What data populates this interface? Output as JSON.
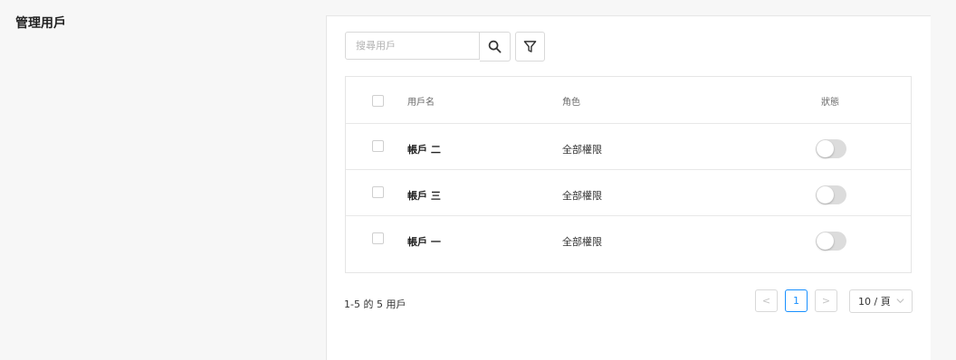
{
  "page": {
    "title": "管理用戶"
  },
  "toolbar": {
    "search_placeholder": "搜尋用戶",
    "search_icon": "search-icon",
    "filter_icon": "filter-icon"
  },
  "table": {
    "columns": {
      "name": "用戶名",
      "role": "角色",
      "status": "狀態"
    },
    "rows": [
      {
        "name": "帳戶 二",
        "role": "全部權限",
        "enabled": false
      },
      {
        "name": "帳戶 三",
        "role": "全部權限",
        "enabled": false
      },
      {
        "name": "帳戶 一",
        "role": "全部權限",
        "enabled": false
      }
    ]
  },
  "footer": {
    "count_text": "1-5 的 5 用戶",
    "prev_label": "<",
    "current_page": "1",
    "next_label": ">",
    "page_size_label": "10 / 頁"
  },
  "colors": {
    "accent": "#1890ff",
    "toggle_off": "#dcdcdc",
    "border": "#d9d9d9"
  }
}
